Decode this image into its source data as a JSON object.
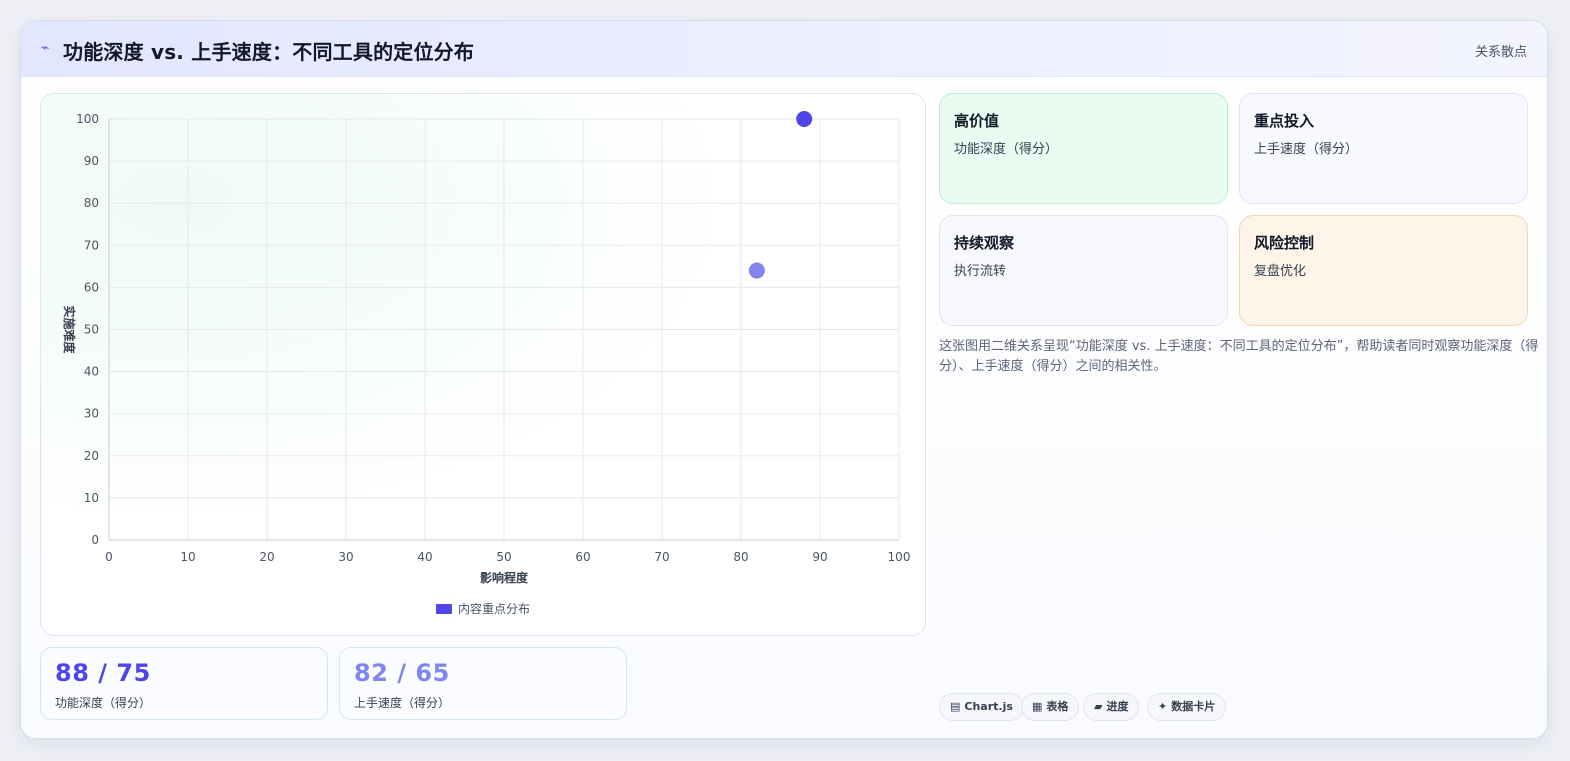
{
  "header": {
    "title": "功能深度 vs. 上手速度：不同工具的定位分布",
    "tag": "关系散点",
    "icon": "pulse-icon"
  },
  "chart_data": {
    "type": "scatter",
    "xlabel": "影响程度",
    "ylabel": "实施难度",
    "xlim": [
      0,
      100
    ],
    "ylim": [
      0,
      100
    ],
    "xticks": [
      "0",
      "10",
      "20",
      "30",
      "40",
      "50",
      "60",
      "70",
      "80",
      "90",
      "100"
    ],
    "yticks": [
      "0",
      "10",
      "20",
      "30",
      "40",
      "50",
      "60",
      "70",
      "80",
      "90",
      "100"
    ],
    "grid": true,
    "legend_position": "bottom",
    "series": [
      {
        "name": "内容重点分布",
        "color": "#5046e5",
        "points": [
          {
            "x": 88,
            "y": 100,
            "color": "#4f46e5"
          },
          {
            "x": 82,
            "y": 64,
            "color": "#7f86ee"
          }
        ]
      }
    ]
  },
  "stats": [
    {
      "value": "88 / 75",
      "caption": "功能深度（得分）",
      "color": "#4f46e5"
    },
    {
      "value": "82 / 65",
      "caption": "上手速度（得分）",
      "color": "#7f86ee"
    }
  ],
  "quadrants": [
    {
      "title": "高价值",
      "subtitle": "功能深度（得分）"
    },
    {
      "title": "重点投入",
      "subtitle": "上手速度（得分）"
    },
    {
      "title": "持续观察",
      "subtitle": "执行流转"
    },
    {
      "title": "风险控制",
      "subtitle": "复盘优化"
    }
  ],
  "description": "这张图用二维关系呈现“功能深度 vs. 上手速度：不同工具的定位分布”，帮助读者同时观察功能深度（得分）、上手速度（得分）之间的相关性。",
  "chips": [
    {
      "icon": "▤",
      "label": "Chart.js"
    },
    {
      "icon": "▦",
      "label": "表格"
    },
    {
      "icon": "▰",
      "label": "进度"
    },
    {
      "icon": "✦",
      "label": "数据卡片"
    }
  ]
}
